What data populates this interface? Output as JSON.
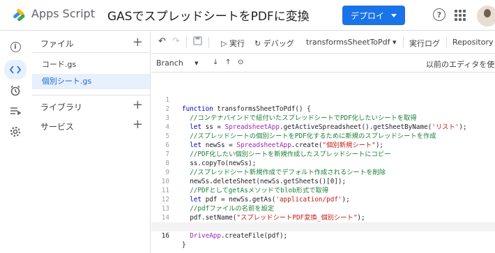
{
  "header": {
    "app_name": "Apps Script",
    "project_title": "GASでスプレッドシートをPDFに変換",
    "deploy_label": "デプロイ",
    "help_glyph": "?"
  },
  "rail": {
    "items": [
      "info",
      "code",
      "triggers",
      "executions",
      "settings"
    ]
  },
  "sidebar": {
    "files_label": "ファイル",
    "files": [
      "コード.gs",
      "個別シート.gs"
    ],
    "libraries_label": "ライブラリ",
    "services_label": "サービス"
  },
  "toolbar": {
    "run_label": "実行",
    "debug_label": "デバッグ",
    "function_name": "transformsSheetToPdf",
    "log_label": "実行ログ",
    "repository_label": "Repository"
  },
  "subbar": {
    "branch_label": "Branch",
    "prev_editor_label": "以前のエディタを使用"
  },
  "code": {
    "line_numbers": [
      "1",
      "2",
      "3",
      "4",
      "5",
      "6",
      "7",
      "8",
      "9",
      "10",
      "11",
      "12",
      "13",
      "14",
      "15",
      "16"
    ]
  }
}
